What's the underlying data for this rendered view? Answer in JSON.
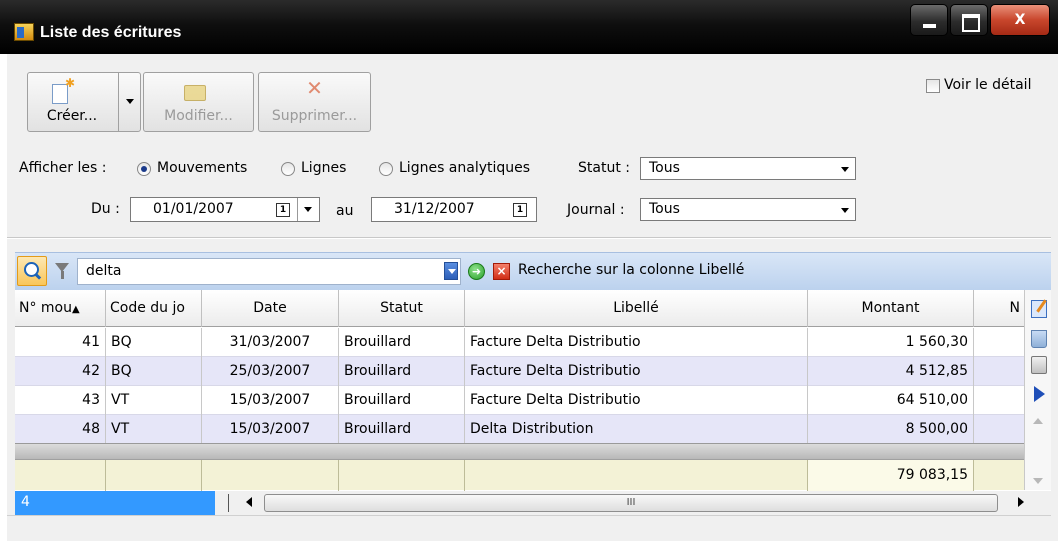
{
  "window": {
    "title": "Liste des écritures",
    "minimize_label": "",
    "maximize_label": "",
    "close_label": "X"
  },
  "toolbar": {
    "create_label": "Créer...",
    "modify_label": "Modifier...",
    "delete_label": "Supprimer...",
    "detail_checkbox_label": "Voir le détail",
    "detail_checked": false
  },
  "filters": {
    "show_label": "Afficher les :",
    "options": [
      "Mouvements",
      "Lignes",
      "Lignes analytiques"
    ],
    "selected_option": "Mouvements",
    "status_label": "Statut :",
    "status_value": "Tous",
    "from_label": "Du :",
    "from_date": "01/01/2007",
    "to_label": "au",
    "to_date": "31/12/2007",
    "journal_label": "Journal :",
    "journal_value": "Tous"
  },
  "search": {
    "value": "delta",
    "hint": "Recherche sur la colonne Libellé"
  },
  "grid": {
    "columns": [
      "N° mou",
      "Code du jo",
      "Date",
      "Statut",
      "Libellé",
      "Montant",
      "N"
    ],
    "sorted_column": "N° mou",
    "rows": [
      {
        "num": "41",
        "journal": "BQ",
        "date": "31/03/2007",
        "status": "Brouillard",
        "label": "Facture Delta Distributio",
        "amount": "1 560,30"
      },
      {
        "num": "42",
        "journal": "BQ",
        "date": "25/03/2007",
        "status": "Brouillard",
        "label": "Facture Delta Distributio",
        "amount": "4 512,85"
      },
      {
        "num": "43",
        "journal": "VT",
        "date": "15/03/2007",
        "status": "Brouillard",
        "label": "Facture Delta Distributio",
        "amount": "64 510,00"
      },
      {
        "num": "48",
        "journal": "VT",
        "date": "15/03/2007",
        "status": "Brouillard",
        "label": "Delta Distribution",
        "amount": "8 500,00"
      }
    ],
    "total": "79 083,15",
    "record_count": "4",
    "scroll_grip": "III"
  },
  "colors": {
    "selection_blue": "#3399ff",
    "alt_row": "#e6e6f8",
    "total_row": "#f3f2d6",
    "search_bar": "#bcd2ee"
  },
  "icons": [
    "window-icon",
    "new-document-icon",
    "folder-icon",
    "delete-x-icon",
    "search-icon",
    "filter-icon",
    "go-icon",
    "cancel-icon",
    "calendar-icon",
    "edit-icon",
    "bin-icon",
    "print-icon",
    "next-icon"
  ]
}
